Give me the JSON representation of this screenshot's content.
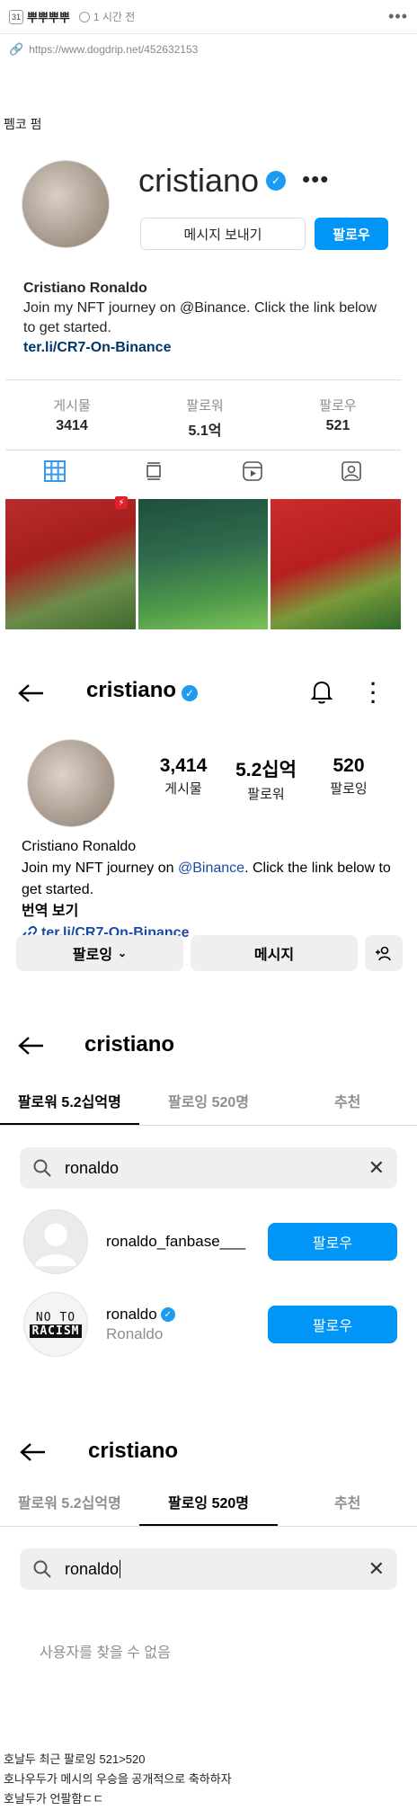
{
  "post": {
    "author": "뿌뿌뿌뿌",
    "time": "1 시간 전",
    "url": "https://www.dogdrip.net/452632153",
    "caption": "펨코 펌"
  },
  "shot1": {
    "username": "cristiano",
    "message_button": "메시지 보내기",
    "follow_button": "팔로우",
    "full_name": "Cristiano Ronaldo",
    "bio": "Join my NFT journey on @Binance. Click the link below to get started.",
    "link": "ter.li/CR7-On-Binance",
    "stats": [
      {
        "label": "게시물",
        "value": "3414"
      },
      {
        "label": "팔로워",
        "value": "5.1억"
      },
      {
        "label": "팔로우",
        "value": "521"
      }
    ]
  },
  "shot2": {
    "username": "cristiano",
    "counts": [
      {
        "value": "3,414",
        "label": "게시물"
      },
      {
        "value": "5.2십억",
        "label": "팔로워"
      },
      {
        "value": "520",
        "label": "팔로잉"
      }
    ],
    "full_name": "Cristiano Ronaldo",
    "bio_before": "Join my NFT journey on ",
    "bio_mention": "@Binance",
    "bio_after": ". Click the link below to get started.",
    "translate": "번역 보기",
    "link": "ter.li/CR7-On-Binance",
    "following_button": "팔로잉",
    "message_button": "메시지"
  },
  "shot3": {
    "username": "cristiano",
    "tabs": [
      "팔로워 5.2십억명",
      "팔로잉 520명",
      "추천"
    ],
    "search_value": "ronaldo",
    "results": [
      {
        "handle": "ronaldo_fanbase___",
        "name": "",
        "button": "팔로우"
      },
      {
        "handle": "ronaldo",
        "name": "Ronaldo",
        "button": "팔로우"
      }
    ],
    "avatar_text_top": "NO TO",
    "avatar_text_bottom": "RACISM"
  },
  "shot4": {
    "username": "cristiano",
    "tabs": [
      "팔로워 5.2십억명",
      "팔로잉 520명",
      "추천"
    ],
    "search_value": "ronaldo",
    "empty_message": "사용자를 찾을 수 없음"
  },
  "footer": {
    "line1": "호날두 최근 팔로잉 521>520",
    "line2": "호나우두가 메시의 우승을 공개적으로 축하하자",
    "line3": "호날두가 언팔함ㄷㄷ"
  }
}
